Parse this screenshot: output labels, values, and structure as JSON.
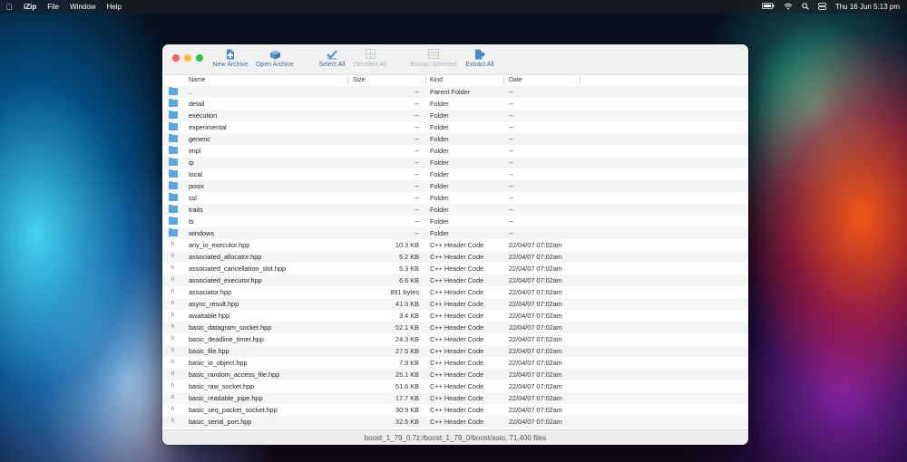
{
  "menubar": {
    "app_name": "iZip",
    "menus": [
      "File",
      "Window",
      "Help"
    ],
    "clock": "Thu 16 Jun  5:13 pm"
  },
  "toolbar": {
    "new_archive": "New Archive",
    "open_archive": "Open Archive",
    "select_all": "Select All",
    "deselect_all": "Deselect All",
    "extract_selected": "Extract Selected",
    "extract_all": "Extract All"
  },
  "columns": {
    "name": "Name",
    "size": "Size",
    "kind": "Kind",
    "date": "Date"
  },
  "rows": [
    {
      "type": "folder",
      "name": "..",
      "size": "--",
      "kind": "Parent Folder",
      "date": "--"
    },
    {
      "type": "folder",
      "name": "detail",
      "size": "--",
      "kind": "Folder",
      "date": "--"
    },
    {
      "type": "folder",
      "name": "execution",
      "size": "--",
      "kind": "Folder",
      "date": "--"
    },
    {
      "type": "folder",
      "name": "experimental",
      "size": "--",
      "kind": "Folder",
      "date": "--"
    },
    {
      "type": "folder",
      "name": "generic",
      "size": "--",
      "kind": "Folder",
      "date": "--"
    },
    {
      "type": "folder",
      "name": "impl",
      "size": "--",
      "kind": "Folder",
      "date": "--"
    },
    {
      "type": "folder",
      "name": "ip",
      "size": "--",
      "kind": "Folder",
      "date": "--"
    },
    {
      "type": "folder",
      "name": "local",
      "size": "--",
      "kind": "Folder",
      "date": "--"
    },
    {
      "type": "folder",
      "name": "posix",
      "size": "--",
      "kind": "Folder",
      "date": "--"
    },
    {
      "type": "folder",
      "name": "ssl",
      "size": "--",
      "kind": "Folder",
      "date": "--"
    },
    {
      "type": "folder",
      "name": "traits",
      "size": "--",
      "kind": "Folder",
      "date": "--"
    },
    {
      "type": "folder",
      "name": "ts",
      "size": "--",
      "kind": "Folder",
      "date": "--"
    },
    {
      "type": "folder",
      "name": "windows",
      "size": "--",
      "kind": "Folder",
      "date": "--"
    },
    {
      "type": "file",
      "name": "any_io_executor.hpp",
      "size": "10.3 KB",
      "kind": "C++ Header Code",
      "date": "22/04/07 07:02am"
    },
    {
      "type": "file",
      "name": "associated_allocator.hpp",
      "size": "5.2 KB",
      "kind": "C++ Header Code",
      "date": "22/04/07 07:02am"
    },
    {
      "type": "file",
      "name": "associated_cancellation_slot.hpp",
      "size": "5.3 KB",
      "kind": "C++ Header Code",
      "date": "22/04/07 07:02am"
    },
    {
      "type": "file",
      "name": "associated_executor.hpp",
      "size": "6.6 KB",
      "kind": "C++ Header Code",
      "date": "22/04/07 07:02am"
    },
    {
      "type": "file",
      "name": "associator.hpp",
      "size": "891 bytes",
      "kind": "C++ Header Code",
      "date": "22/04/07 07:02am"
    },
    {
      "type": "file",
      "name": "async_result.hpp",
      "size": "41.3 KB",
      "kind": "C++ Header Code",
      "date": "22/04/07 07:02am"
    },
    {
      "type": "file",
      "name": "awaitable.hpp",
      "size": "3.4 KB",
      "kind": "C++ Header Code",
      "date": "22/04/07 07:02am"
    },
    {
      "type": "file",
      "name": "basic_datagram_socket.hpp",
      "size": "52.1 KB",
      "kind": "C++ Header Code",
      "date": "22/04/07 07:02am"
    },
    {
      "type": "file",
      "name": "basic_deadline_timer.hpp",
      "size": "24.3 KB",
      "kind": "C++ Header Code",
      "date": "22/04/07 07:02am"
    },
    {
      "type": "file",
      "name": "basic_file.hpp",
      "size": "27.5 KB",
      "kind": "C++ Header Code",
      "date": "22/04/07 07:02am"
    },
    {
      "type": "file",
      "name": "basic_io_object.hpp",
      "size": "7.9 KB",
      "kind": "C++ Header Code",
      "date": "22/04/07 07:02am"
    },
    {
      "type": "file",
      "name": "basic_random_access_file.hpp",
      "size": "25.1 KB",
      "kind": "C++ Header Code",
      "date": "22/04/07 07:02am"
    },
    {
      "type": "file",
      "name": "basic_raw_socket.hpp",
      "size": "51.6 KB",
      "kind": "C++ Header Code",
      "date": "22/04/07 07:02am"
    },
    {
      "type": "file",
      "name": "basic_readable_pipe.hpp",
      "size": "17.7 KB",
      "kind": "C++ Header Code",
      "date": "22/04/07 07:02am"
    },
    {
      "type": "file",
      "name": "basic_seq_packet_socket.hpp",
      "size": "30.9 KB",
      "kind": "C++ Header Code",
      "date": "22/04/07 07:02am"
    },
    {
      "type": "file",
      "name": "basic_serial_port.hpp",
      "size": "32.5 KB",
      "kind": "C++ Header Code",
      "date": "22/04/07 07:02am"
    }
  ],
  "status": "boost_1_79_0.7z:/boost_1_79_0/boost/asio, 71,400 files",
  "colors": {
    "accent": "#3e6f9a",
    "folder": "#5aa7e0"
  }
}
